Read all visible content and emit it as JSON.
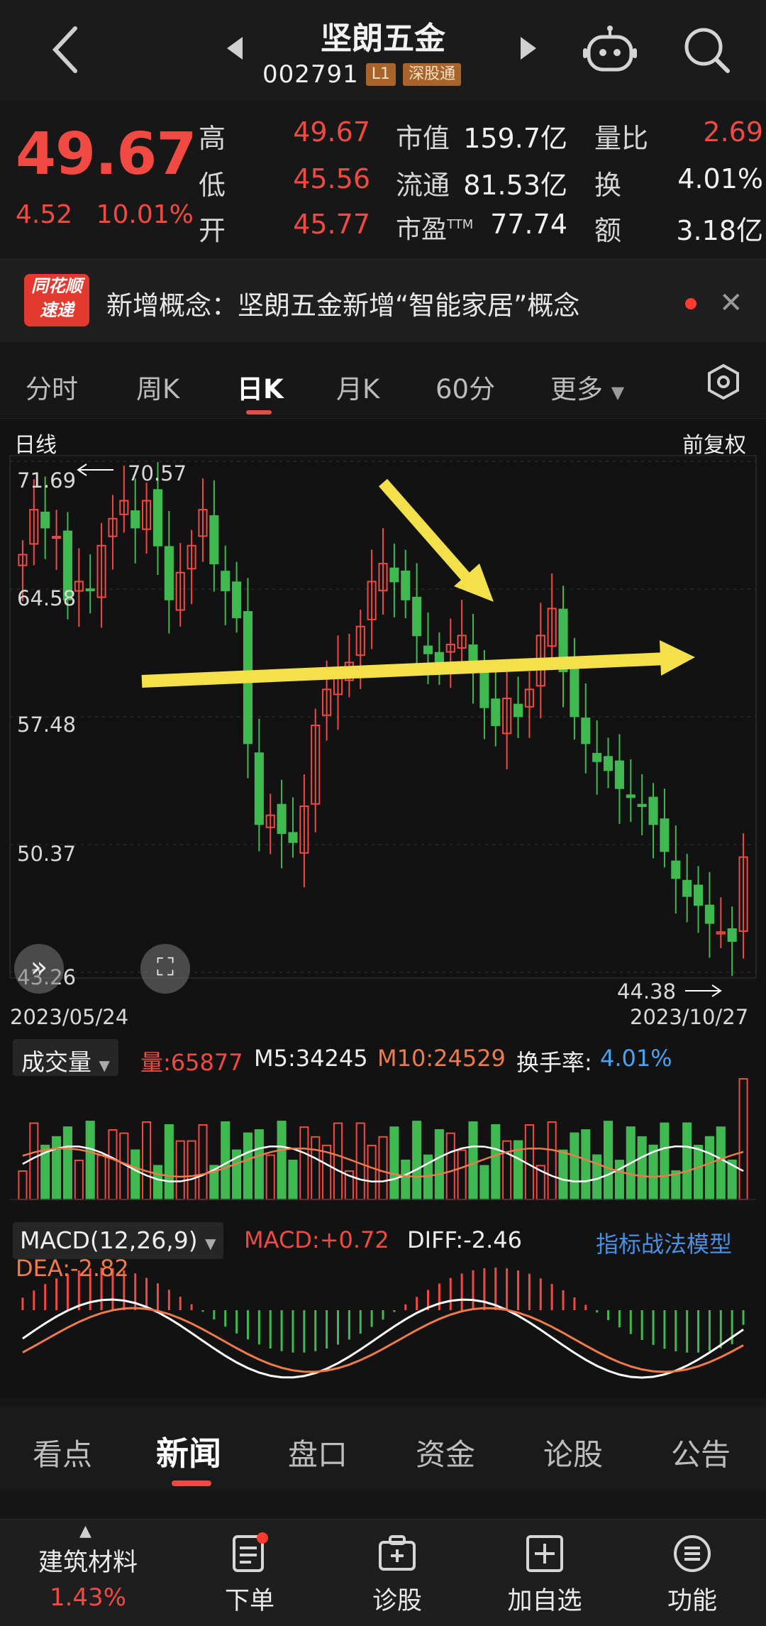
{
  "header": {
    "title": "坚朗五金",
    "code": "002791",
    "tags": [
      "L1",
      "深股通"
    ],
    "back_icon": "chevron-left-icon",
    "robot_icon": "robot-icon",
    "search_icon": "search-icon"
  },
  "quote": {
    "price": "49.67",
    "change": "4.52",
    "change_pct": "10.01%",
    "fields": [
      {
        "label": "高",
        "value": "49.67",
        "color": "red"
      },
      {
        "label": "低",
        "value": "45.56",
        "color": "red"
      },
      {
        "label": "开",
        "value": "45.77",
        "color": "red"
      },
      {
        "label": "市值",
        "value": "159.7亿",
        "color": "white"
      },
      {
        "label": "流通",
        "value": "81.53亿",
        "color": "white"
      },
      {
        "label": "市盈TTM",
        "value": "77.74",
        "color": "white"
      },
      {
        "label": "量比",
        "value": "2.69",
        "color": "red"
      },
      {
        "label": "换",
        "value": "4.01%",
        "color": "white"
      },
      {
        "label": "额",
        "value": "3.18亿",
        "color": "white"
      }
    ]
  },
  "ticker": {
    "logo_line1": "同花顺",
    "logo_line2": "速递",
    "text": "新增概念：坚朗五金新增“智能家居”概念"
  },
  "tabs": [
    "分时",
    "周K",
    "日K",
    "月K",
    "60分",
    "更多"
  ],
  "chart": {
    "label_left": "日线",
    "label_right": "前复权",
    "y_labels": [
      "71.69",
      "64.58",
      "57.48",
      "50.37",
      "43.26"
    ],
    "high_mark": "70.57",
    "low_mark": "44.38",
    "date_start": "2023/05/24",
    "date_end": "2023/10/27"
  },
  "volume": {
    "selector": "成交量",
    "vol": "量:65877",
    "m5": "M5:34245",
    "m10": "M10:24529",
    "turnover_label": "换手率:",
    "turnover_value": "4.01%"
  },
  "macd": {
    "selector": "MACD(12,26,9)",
    "macd": "MACD:+0.72",
    "diff": "DIFF:-2.46",
    "dea": "DEA:-2.82",
    "model_link": "指标战法模型"
  },
  "news_tabs": [
    "看点",
    "新闻",
    "盘口",
    "资金",
    "论股",
    "公告"
  ],
  "bottom_nav": [
    {
      "label": "建筑材料",
      "sub": "1.43%",
      "icon": "caret-up-icon"
    },
    {
      "label": "下单",
      "icon": "order-icon"
    },
    {
      "label": "诊股",
      "icon": "diagnose-icon"
    },
    {
      "label": "加自选",
      "icon": "add-watchlist-icon"
    },
    {
      "label": "功能",
      "icon": "menu-icon"
    }
  ],
  "chart_data": {
    "type": "candlestick",
    "x_range": [
      "2023/05/24",
      "2023/10/27"
    ],
    "ylim": [
      43.26,
      71.69
    ],
    "y_ticks": [
      71.69,
      64.58,
      57.48,
      50.37,
      43.26
    ],
    "period_high": 70.57,
    "period_low": 44.38,
    "last_close": 49.67,
    "close_trend": [
      66.5,
      69.0,
      68.0,
      67.5,
      64.0,
      65.0,
      64.5,
      67.0,
      68.5,
      69.5,
      68.0,
      69.5,
      67.0,
      64.0,
      65.5,
      67.0,
      69.0,
      66.0,
      64.5,
      63.0,
      56.0,
      51.5,
      52.0,
      51.0,
      50.5,
      52.5,
      57.0,
      59.0,
      60.0,
      60.5,
      62.5,
      65.0,
      66.0,
      65.0,
      64.0,
      62.0,
      61.0,
      60.5,
      61.5,
      62.0,
      60.0,
      58.0,
      57.0,
      58.5,
      57.5,
      59.0,
      62.0,
      63.5,
      60.0,
      57.5,
      56.0,
      55.0,
      54.5,
      53.5,
      53.0,
      52.5,
      51.5,
      50.0,
      48.5,
      47.5,
      47.0,
      46.0,
      45.5,
      45.0,
      49.67
    ]
  }
}
